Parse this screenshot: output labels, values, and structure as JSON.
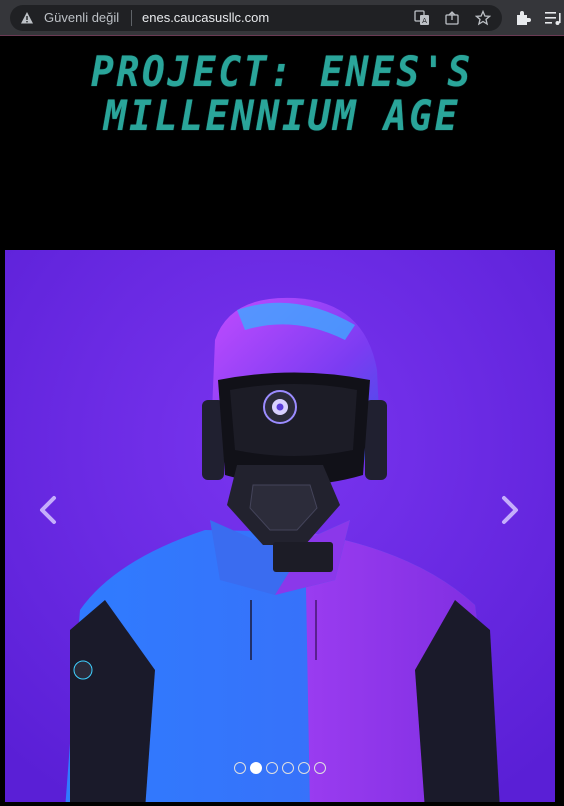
{
  "browser": {
    "security_label": "Güvenli değil",
    "url": "enes.caucasusllc.com",
    "icons": [
      "warning-icon",
      "translate-icon",
      "share-icon",
      "star-icon",
      "extensions-icon",
      "media-control-icon"
    ]
  },
  "header": {
    "title_line1": "PROJECT: ENES'S",
    "title_line2": "MILLENNIUM AGE",
    "title_color": "#2aa59a"
  },
  "carousel": {
    "slide_count": 6,
    "active_index": 1,
    "background_color": "#6a2ee8",
    "prev_icon": "chevron-left-icon",
    "next_icon": "chevron-right-icon"
  }
}
